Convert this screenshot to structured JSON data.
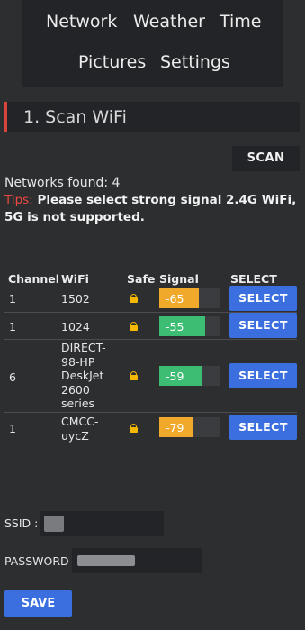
{
  "nav": {
    "network": "Network",
    "weather": "Weather",
    "time": "Time",
    "pictures": "Pictures",
    "settings": "Settings"
  },
  "section": {
    "title": "1. Scan WiFi"
  },
  "scan": {
    "label": "SCAN"
  },
  "status": {
    "networks_found": "Networks found: 4"
  },
  "tips": {
    "label": "Tips:",
    "text": "Please select strong signal 2.4G WiFi, 5G is not supported."
  },
  "table": {
    "headers": {
      "channel": "Channel",
      "wifi": "WiFi",
      "safe": "Safe",
      "signal": "Signal",
      "select": "SELECT"
    },
    "rows": [
      {
        "channel": "1",
        "wifi": "1502",
        "signal": "-65",
        "signal_color": "#f0a92b",
        "select_label": "SELECT"
      },
      {
        "channel": "1",
        "wifi": "1024",
        "signal": "-55",
        "signal_color": "#3dbd73",
        "select_label": "SELECT"
      },
      {
        "channel": "6",
        "wifi": "DIRECT-98-HP DeskJet 2600 series",
        "signal": "-59",
        "signal_color": "#3dbd73",
        "select_label": "SELECT"
      },
      {
        "channel": "1",
        "wifi": "CMCC-uycZ",
        "signal": "-79",
        "signal_color": "#f0a92b",
        "select_label": "SELECT"
      }
    ]
  },
  "form": {
    "ssid_label": "SSID :",
    "password_label": "PASSWORD :",
    "save_label": "SAVE"
  },
  "colors": {
    "accent_red": "#d9443c",
    "button_blue": "#3b6fe0",
    "signal_good": "#3dbd73",
    "signal_fair": "#f0a92b",
    "lock": "#f5b800"
  }
}
